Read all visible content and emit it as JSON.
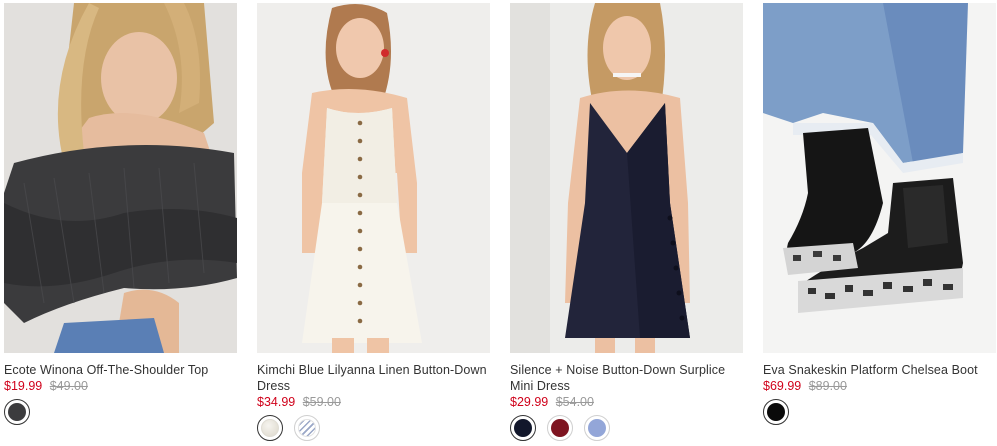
{
  "products": [
    {
      "name": "Ecote Winona Off-The-Shoulder Top",
      "sale_price": "$19.99",
      "original_price": "$49.00",
      "swatches": [
        {
          "color": "#3c3c3e",
          "style": "solid",
          "selected": true
        }
      ]
    },
    {
      "name": "Kimchi Blue Lilyanna Linen Button-Down Dress",
      "sale_price": "$34.99",
      "original_price": "$59.00",
      "swatches": [
        {
          "color": "#ebe7dd",
          "style": "linen",
          "selected": true
        },
        {
          "color": "#9aa7c7",
          "style": "striped",
          "selected": false
        }
      ]
    },
    {
      "name": "Silence + Noise Button-Down Surplice Mini Dress",
      "sale_price": "$29.99",
      "original_price": "$54.00",
      "swatches": [
        {
          "color": "#12172b",
          "style": "solid",
          "selected": true
        },
        {
          "color": "#7e1420",
          "style": "solid",
          "selected": false
        },
        {
          "color": "#93a6d8",
          "style": "solid",
          "selected": false
        }
      ]
    },
    {
      "name": "Eva Snakeskin Platform Chelsea Boot",
      "sale_price": "$69.99",
      "original_price": "$89.00",
      "swatches": [
        {
          "color": "#0a0a0a",
          "style": "solid",
          "selected": true
        }
      ]
    }
  ],
  "colors": {
    "sale_price": "#d0021b",
    "original_price": "#9a9a9a",
    "product_name": "#333333"
  }
}
